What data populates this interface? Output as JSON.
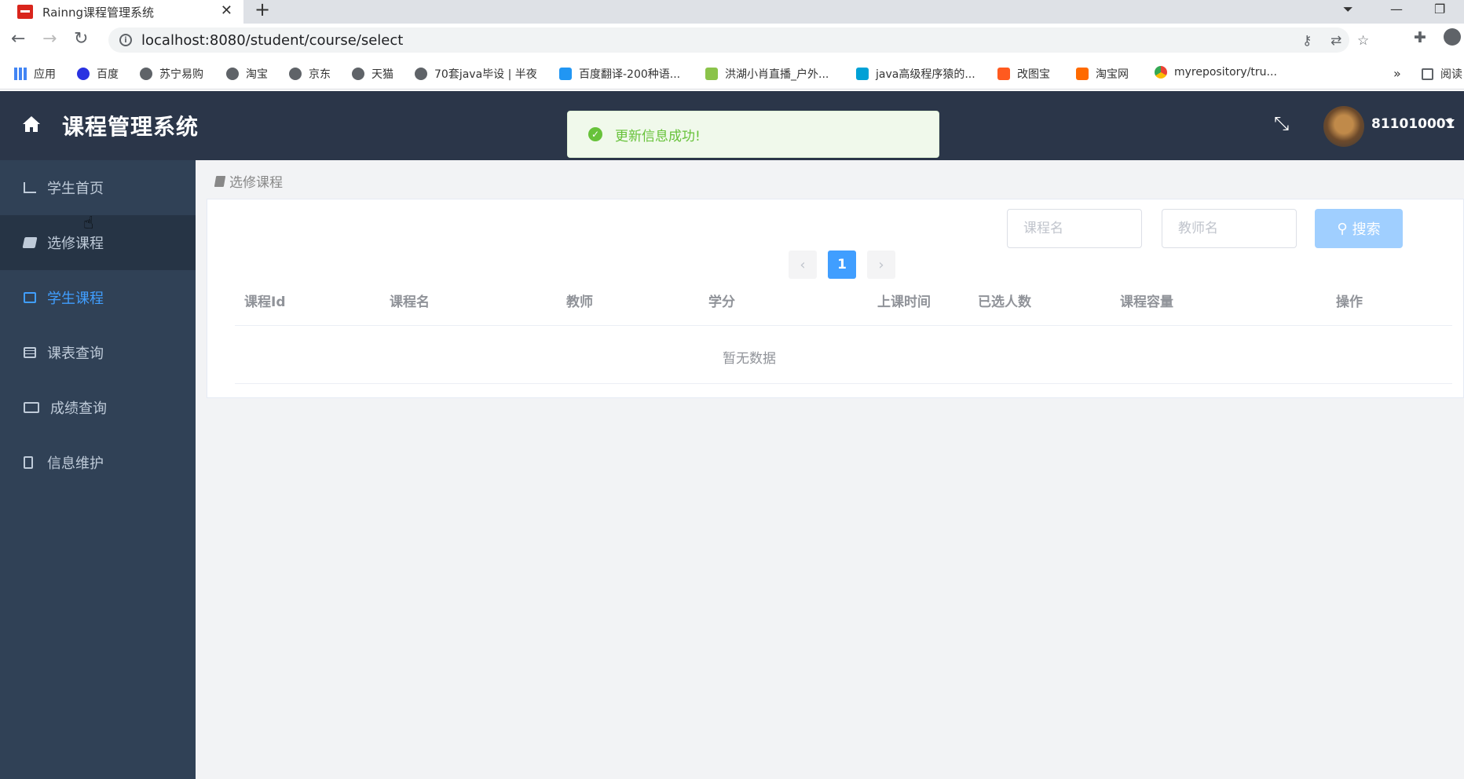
{
  "browser": {
    "tab_title": "Rainng课程管理系统",
    "tab_close": "✕",
    "new_tab": "+",
    "url": "localhost:8080/student/course/select",
    "bookmarks": [
      {
        "label": "应用",
        "icon": "apps-icon"
      },
      {
        "label": "百度",
        "icon": "baidu-icon"
      },
      {
        "label": "苏宁易购",
        "icon": "globe-icon"
      },
      {
        "label": "淘宝",
        "icon": "globe-icon"
      },
      {
        "label": "京东",
        "icon": "globe-icon"
      },
      {
        "label": "天猫",
        "icon": "globe-icon"
      },
      {
        "label": "70套java毕设 | 半夜",
        "icon": "globe-icon"
      },
      {
        "label": "百度翻译-200种语...",
        "icon": "fanyi-icon"
      },
      {
        "label": "洪湖小肖直播_户外...",
        "icon": "hh-icon"
      },
      {
        "label": "java高级程序猿的...",
        "icon": "bilibili-icon"
      },
      {
        "label": "改图宝",
        "icon": "gaitubao-icon"
      },
      {
        "label": "淘宝网",
        "icon": "taobao-icon"
      },
      {
        "label": "myrepository/tru...",
        "icon": "chrome-icon"
      }
    ],
    "bookmarks_more": "»",
    "reading_list": "阅读"
  },
  "header": {
    "title": "课程管理系统",
    "username": "811010001"
  },
  "toast": {
    "message": "更新信息成功!"
  },
  "sidebar": {
    "items": [
      {
        "label": "学生首页",
        "icon": "bar-chart-icon"
      },
      {
        "label": "选修课程",
        "icon": "book-icon"
      },
      {
        "label": "学生课程",
        "icon": "edit-icon"
      },
      {
        "label": "课表查询",
        "icon": "table-icon"
      },
      {
        "label": "成绩查询",
        "icon": "newspaper-icon"
      },
      {
        "label": "信息维护",
        "icon": "id-card-icon"
      }
    ],
    "active_color": "#409eff"
  },
  "main": {
    "breadcrumb": "选修课程",
    "search": {
      "course_placeholder": "课程名",
      "teacher_placeholder": "教师名",
      "button_label": "搜索"
    },
    "pagination": {
      "prev": "‹",
      "current": "1",
      "next": "›"
    },
    "table": {
      "headers": [
        "课程Id",
        "课程名",
        "教师",
        "学分",
        "上课时间",
        "已选人数",
        "课程容量",
        "操作"
      ],
      "empty_text": "暂无数据"
    }
  }
}
